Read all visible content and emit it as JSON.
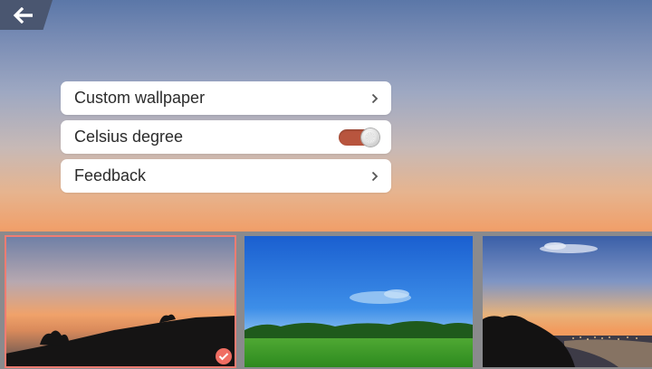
{
  "header": {
    "back_icon": "arrow-left-icon"
  },
  "settings": {
    "items": [
      {
        "label": "Custom wallpaper",
        "control": "chevron-right-icon"
      },
      {
        "label": "Celsius degree",
        "control": "toggle",
        "toggle_on": true
      },
      {
        "label": "Feedback",
        "control": "chevron-right-icon"
      }
    ]
  },
  "wallpapers": {
    "items": [
      {
        "scene": "sunset-hill-silhouette",
        "selected": true,
        "badge_icon": "check-circle-icon"
      },
      {
        "scene": "blue-sky-green-field",
        "selected": false
      },
      {
        "scene": "dusk-coastline-lights",
        "selected": false
      }
    ]
  },
  "colors": {
    "accent": "#ef6d62",
    "toggle_on": "#b8553e",
    "back_button_bg": "#4a5670"
  }
}
